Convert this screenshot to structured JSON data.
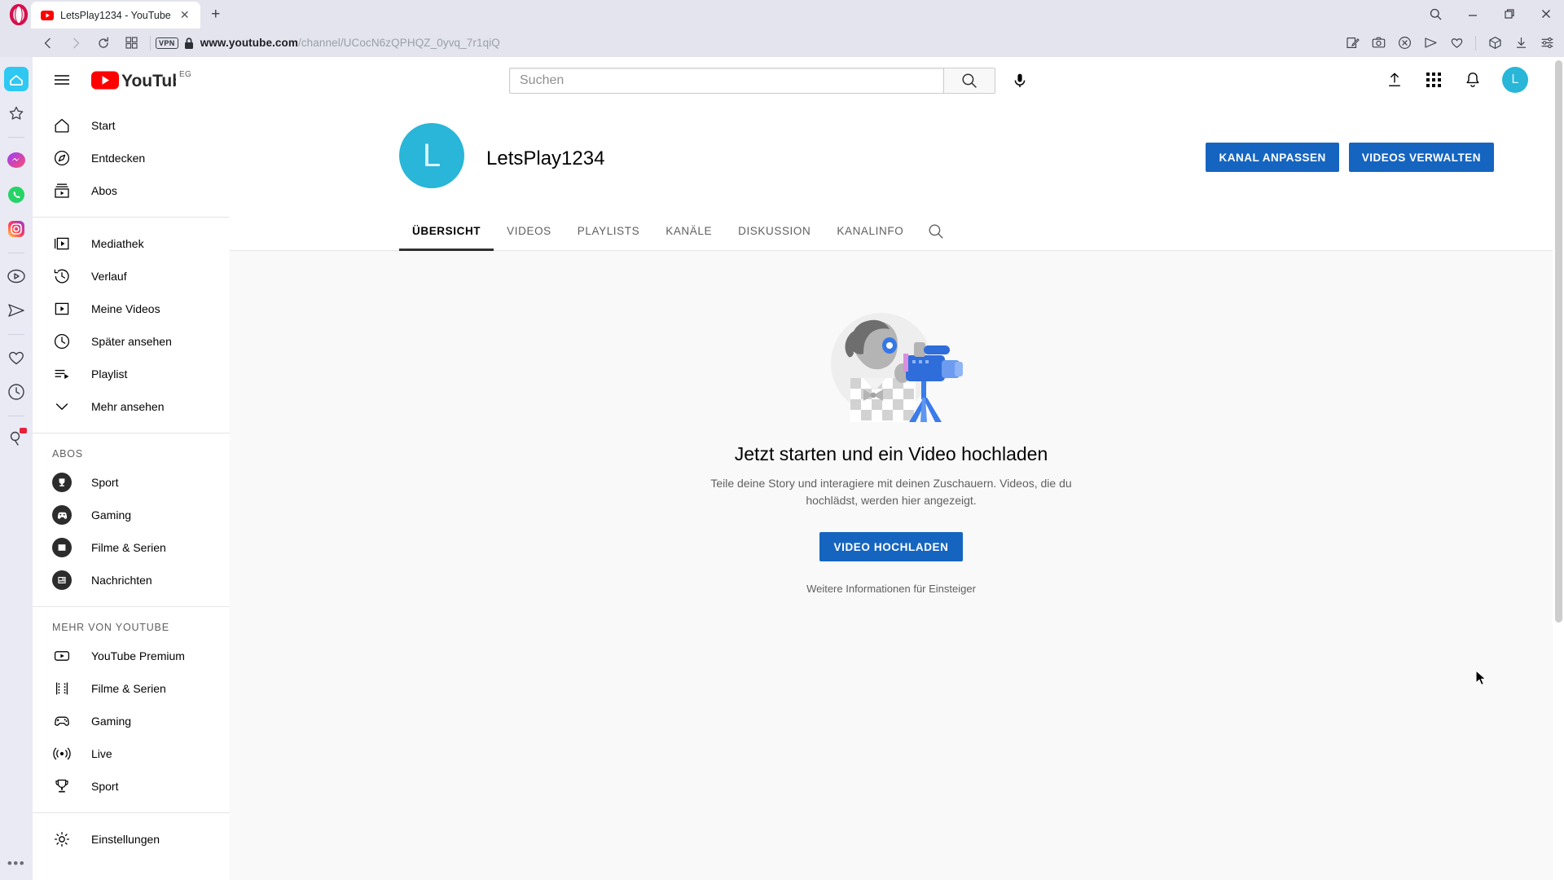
{
  "browser": {
    "name": "Opera",
    "tab": {
      "title": "LetsPlay1234 - YouTube",
      "favicon": "youtube-favicon",
      "close_label": "✕"
    },
    "new_tab_label": "+",
    "nav": {
      "back": "back-icon",
      "forward": "forward-icon",
      "reload": "reload-icon",
      "speeddial": "speed-dial-icon"
    },
    "security": {
      "vpn_label": "VPN",
      "lock": "lock-icon"
    },
    "address": {
      "domain": "www.youtube.com",
      "path": "/channel/UCocN6zQPHQZ_0yvq_7r1qiQ"
    },
    "address_actions": [
      "edit-note-icon",
      "camera-snapshot-icon",
      "ad-block-icon",
      "send-icon",
      "heart-icon",
      "extensions-cube-icon",
      "downloads-icon",
      "easy-setup-icon"
    ],
    "window_controls": {
      "search": "search-icon",
      "minimize": "minimize-icon",
      "restore": "restore-icon",
      "close": "close-icon"
    },
    "sidebar": {
      "items": [
        {
          "name": "opera-home",
          "icon": "home-icon"
        },
        {
          "name": "bookmarks",
          "icon": "star-icon"
        },
        {
          "name": "messenger",
          "icon": "messenger-icon"
        },
        {
          "name": "whatsapp",
          "icon": "whatsapp-icon"
        },
        {
          "name": "instagram",
          "icon": "instagram-icon"
        },
        {
          "name": "player",
          "icon": "player-icon"
        },
        {
          "name": "telegram",
          "icon": "telegram-icon"
        },
        {
          "name": "favourites",
          "icon": "heart-icon"
        },
        {
          "name": "history",
          "icon": "clock-icon"
        },
        {
          "name": "pinboards",
          "icon": "pin-icon",
          "badge": true
        }
      ],
      "more_label": "•••"
    }
  },
  "youtube": {
    "header": {
      "menu": "hamburger-icon",
      "logo_text": "YouTube",
      "country_code": "EG",
      "search": {
        "placeholder": "Suchen",
        "value": "",
        "button": "search-icon",
        "mic": "microphone-icon"
      },
      "actions": [
        "upload-video-icon",
        "youtube-apps-icon",
        "notifications-bell-icon"
      ],
      "avatar_letter": "L"
    },
    "guide": {
      "main": [
        {
          "label": "Start",
          "icon": "home-icon"
        },
        {
          "label": "Entdecken",
          "icon": "compass-icon"
        },
        {
          "label": "Abos",
          "icon": "subscriptions-icon"
        }
      ],
      "library": [
        {
          "label": "Mediathek",
          "icon": "library-icon"
        },
        {
          "label": "Verlauf",
          "icon": "history-icon"
        },
        {
          "label": "Meine Videos",
          "icon": "my-videos-icon"
        },
        {
          "label": "Später ansehen",
          "icon": "watch-later-icon"
        },
        {
          "label": "Playlist",
          "icon": "playlist-icon"
        },
        {
          "label": "Mehr ansehen",
          "icon": "chevron-down-icon"
        }
      ],
      "subs_heading": "ABOS",
      "subs": [
        {
          "label": "Sport",
          "icon": "trophy-avatar"
        },
        {
          "label": "Gaming",
          "icon": "gaming-avatar"
        },
        {
          "label": "Filme & Serien",
          "icon": "film-avatar"
        },
        {
          "label": "Nachrichten",
          "icon": "news-avatar"
        }
      ],
      "more_heading": "MEHR VON YOUTUBE",
      "more": [
        {
          "label": "YouTube Premium",
          "icon": "youtube-premium-icon"
        },
        {
          "label": "Filme & Serien",
          "icon": "film-strip-icon"
        },
        {
          "label": "Gaming",
          "icon": "gamepad-icon"
        },
        {
          "label": "Live",
          "icon": "live-broadcast-icon"
        },
        {
          "label": "Sport",
          "icon": "trophy-icon"
        }
      ],
      "settings": {
        "label": "Einstellungen",
        "icon": "gear-icon"
      }
    },
    "channel": {
      "avatar_letter": "L",
      "name": "LetsPlay1234",
      "customize_button": "KANAL ANPASSEN",
      "manage_videos_button": "VIDEOS VERWALTEN",
      "tabs": [
        {
          "label": "ÜBERSICHT",
          "active": true
        },
        {
          "label": "VIDEOS",
          "active": false
        },
        {
          "label": "PLAYLISTS",
          "active": false
        },
        {
          "label": "KANÄLE",
          "active": false
        },
        {
          "label": "DISKUSSION",
          "active": false
        },
        {
          "label": "KANALINFO",
          "active": false
        }
      ],
      "tab_search_icon": "search-icon"
    },
    "empty_state": {
      "illustration": "creator-with-camera-illustration",
      "title": "Jetzt starten und ein Video hochladen",
      "subtitle": "Teile deine Story und interagiere mit deinen Zuschauern. Videos, die du hochlädst, werden hier angezeigt.",
      "upload_button": "VIDEO HOCHLADEN",
      "link": "Weitere Informationen für Einsteiger"
    }
  },
  "colors": {
    "yt_red": "#ff0000",
    "button_blue": "#1565c0",
    "avatar_teal": "#29b6d8",
    "opera_red": "#d6104a",
    "chrome_bg": "#e3e4ee",
    "page_bg": "#f9f9f9"
  }
}
